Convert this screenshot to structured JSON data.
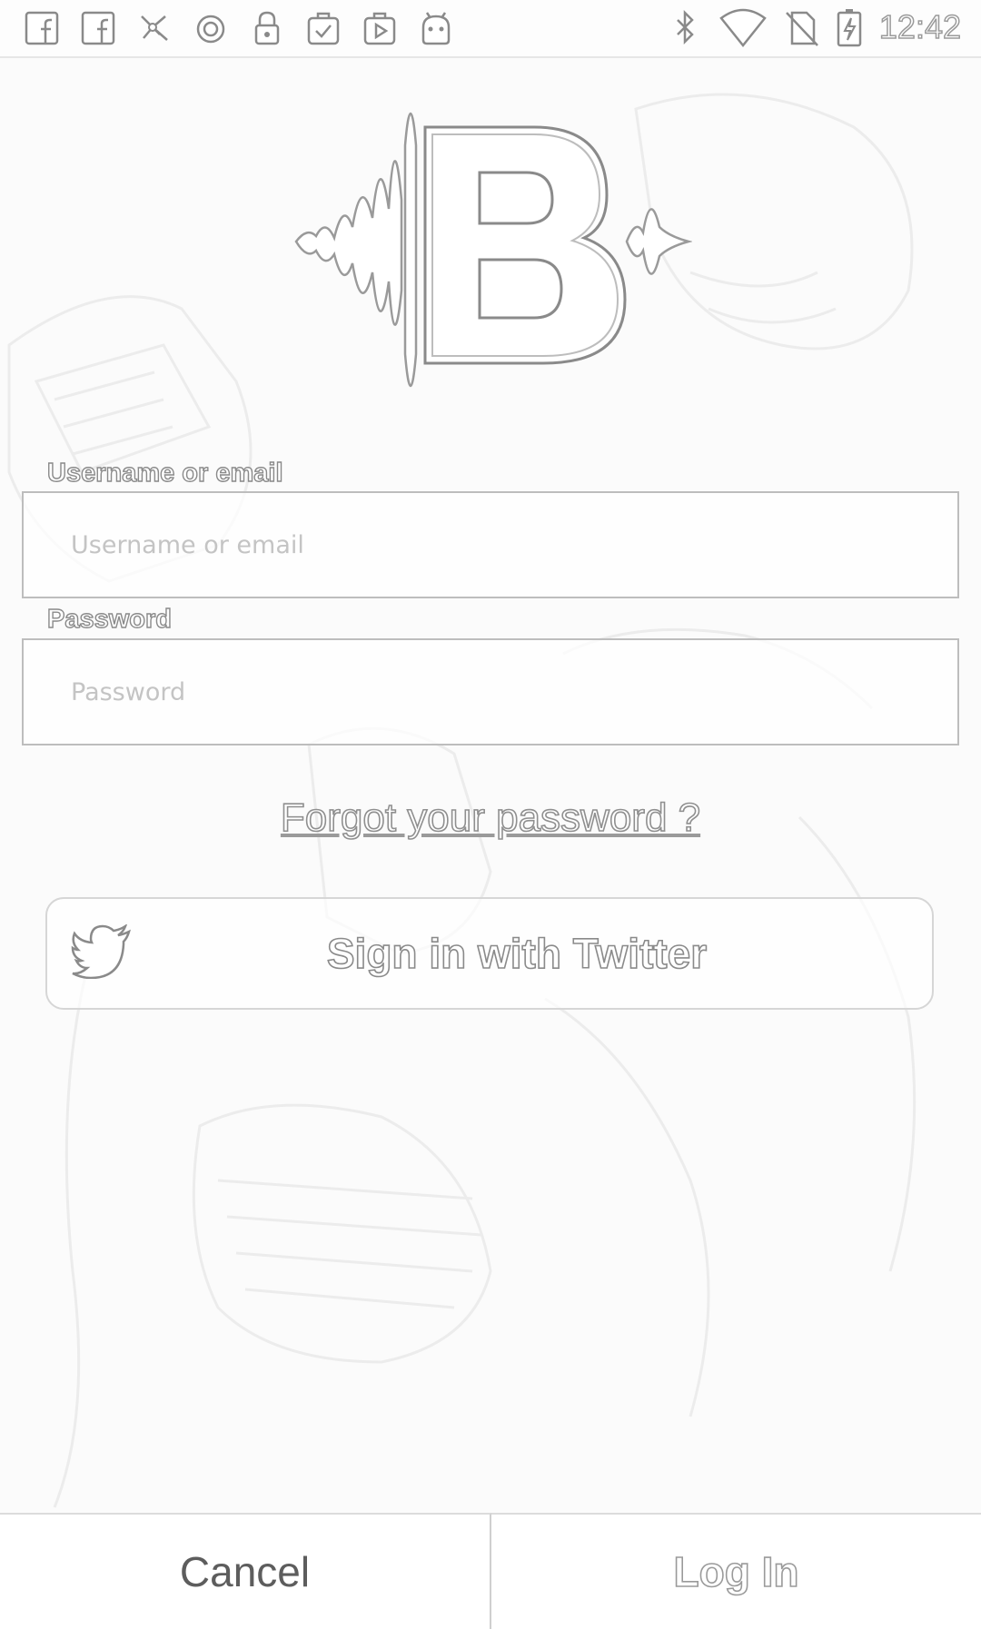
{
  "status_bar": {
    "time": "12:42",
    "left_icons": [
      "facebook-icon",
      "facebook-icon",
      "fan-icon",
      "circle-icon",
      "lock-icon",
      "task-icon",
      "play-store-icon",
      "android-icon"
    ],
    "right_icons": [
      "bluetooth-icon",
      "wifi-icon",
      "no-sim-icon",
      "battery-charging-icon"
    ]
  },
  "logo": {
    "letter": "B",
    "icon": "sound-wave-logo"
  },
  "form": {
    "username": {
      "label": "Username or email",
      "placeholder": "Username or email",
      "value": ""
    },
    "password": {
      "label": "Password",
      "placeholder": "Password",
      "value": ""
    },
    "forgot_link": "Forgot your password ?",
    "twitter_button": {
      "label": "Sign in with Twitter",
      "icon": "twitter-bird-icon"
    }
  },
  "bottom_bar": {
    "cancel_label": "Cancel",
    "login_label": "Log In"
  },
  "colors": {
    "background": "#fbfbfb",
    "outline_text": "#8a8a8a",
    "cancel_text": "#5d5d5d",
    "border": "#bdbdbd"
  }
}
